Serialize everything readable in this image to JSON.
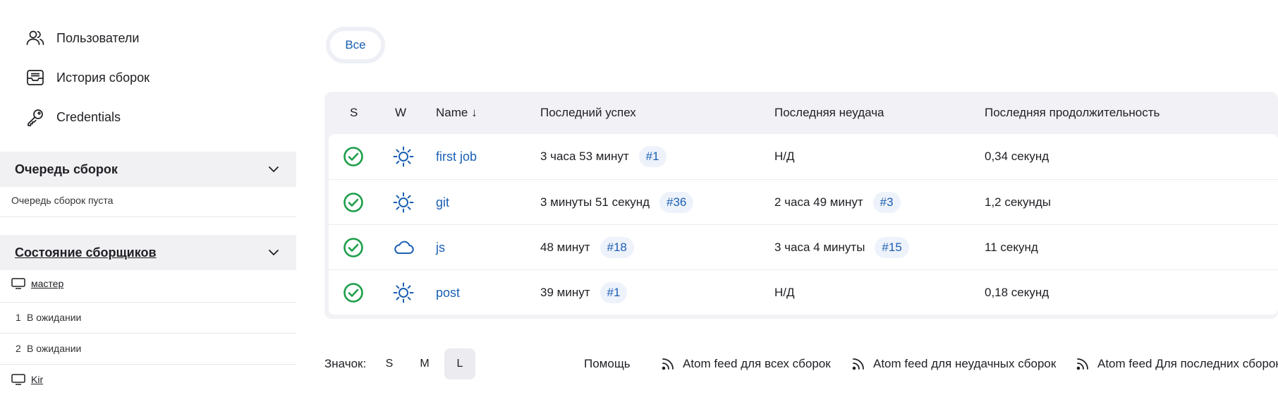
{
  "sidebar": {
    "nav": [
      {
        "label": "Пользователи",
        "icon": "users-icon"
      },
      {
        "label": "История сборок",
        "icon": "inbox-icon"
      },
      {
        "label": "Credentials",
        "icon": "key-icon"
      }
    ],
    "queue": {
      "title": "Очередь сборок",
      "empty_text": "Очередь сборок пуста"
    },
    "executors": {
      "title": "Состояние сборщиков",
      "nodes": [
        {
          "name": "мастер",
          "slots": [
            {
              "num": "1",
              "status": "В ожидании"
            },
            {
              "num": "2",
              "status": "В ожидании"
            }
          ]
        },
        {
          "name": "Kir"
        }
      ]
    }
  },
  "view_tabs": {
    "all_label": "Все"
  },
  "table": {
    "headers": {
      "s": "S",
      "w": "W",
      "name": "Name ↓",
      "last_success": "Последний успех",
      "last_failure": "Последняя неудача",
      "last_duration": "Последняя продолжительность"
    },
    "rows": [
      {
        "name": "first job",
        "weather": "sun",
        "success": "3 часа 53 минут",
        "success_build": "#1",
        "failure": "Н/Д",
        "failure_build": "",
        "duration": "0,34 секунд"
      },
      {
        "name": "git",
        "weather": "sun",
        "success": "3 минуты 51 секунд",
        "success_build": "#36",
        "failure": "2 часа 49 минут",
        "failure_build": "#3",
        "duration": "1,2 секунды"
      },
      {
        "name": "js",
        "weather": "cloud",
        "success": "48 минут",
        "success_build": "#18",
        "failure": "3 часа 4 минуты",
        "failure_build": "#15",
        "duration": "11 секунд"
      },
      {
        "name": "post",
        "weather": "sun",
        "success": "39 минут",
        "success_build": "#1",
        "failure": "Н/Д",
        "failure_build": "",
        "duration": "0,18 секунд"
      }
    ]
  },
  "footer": {
    "icon_label": "Значок:",
    "sizes": [
      "S",
      "M",
      "L"
    ],
    "active_size": "L",
    "help": "Помощь",
    "feeds": [
      "Atom feed для всех сборок",
      "Atom feed для неудачных сборок",
      "Atom feed Для последних сборок"
    ]
  },
  "colors": {
    "accent": "#1a5fb4",
    "success": "#1e9e4a"
  }
}
